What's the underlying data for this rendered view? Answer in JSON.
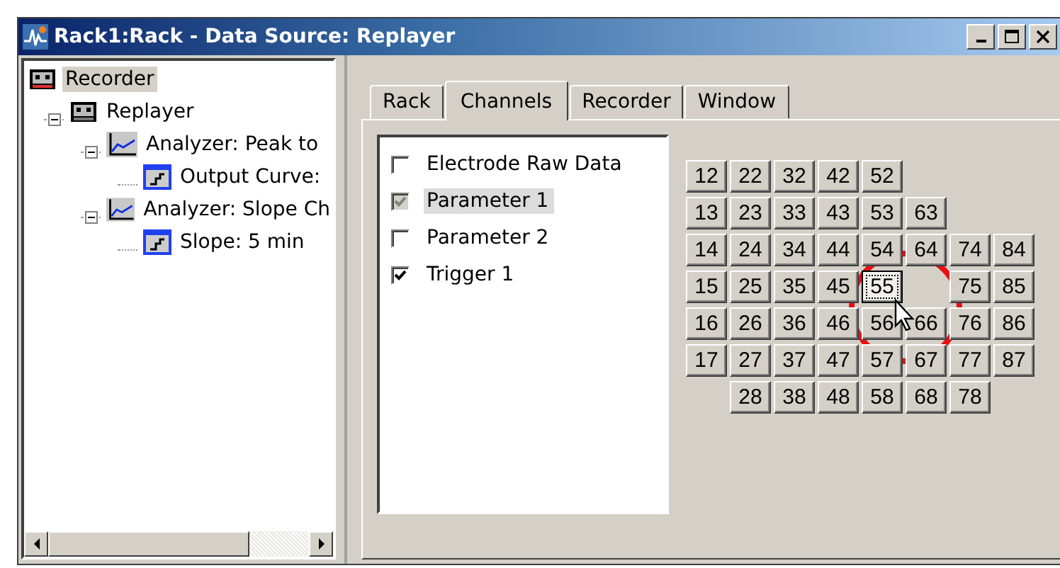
{
  "window": {
    "title": "Rack1:Rack - Data Source: Replayer"
  },
  "tree": [
    {
      "label": "Recorder",
      "kind": "device",
      "selected": true,
      "children": [
        {
          "label": "Replayer",
          "kind": "device",
          "selected": false,
          "expanded": true,
          "children": [
            {
              "label": "Analyzer: Peak to",
              "kind": "analyzer",
              "selected": false,
              "expanded": true,
              "children": [
                {
                  "label": "Output Curve:",
                  "kind": "output",
                  "selected": false
                }
              ]
            },
            {
              "label": "Analyzer: Slope Ch",
              "kind": "analyzer",
              "selected": false,
              "expanded": true,
              "children": [
                {
                  "label": "Slope: 5 min",
                  "kind": "output",
                  "selected": false
                }
              ]
            }
          ]
        }
      ]
    }
  ],
  "tabs": [
    {
      "label": "Rack",
      "selected": false
    },
    {
      "label": "Channels",
      "selected": true
    },
    {
      "label": "Recorder",
      "selected": false
    },
    {
      "label": "Window",
      "selected": false
    }
  ],
  "channel_list": [
    {
      "label": "Electrode Raw Data",
      "checked": false,
      "disabled": false,
      "selected": false
    },
    {
      "label": "Parameter 1",
      "checked": true,
      "disabled": true,
      "selected": true
    },
    {
      "label": "Parameter 2",
      "checked": false,
      "disabled": false,
      "selected": false
    },
    {
      "label": "Trigger 1",
      "checked": true,
      "disabled": false,
      "selected": false
    }
  ],
  "electrode_grid": [
    [
      {
        "kind": "button",
        "label": "12",
        "selected": false
      },
      {
        "kind": "button",
        "label": "22",
        "selected": false
      },
      {
        "kind": "button",
        "label": "32",
        "selected": false
      },
      {
        "kind": "button",
        "label": "42",
        "selected": false
      },
      {
        "kind": "button",
        "label": "52",
        "selected": false
      }
    ],
    [
      {
        "kind": "button",
        "label": "13",
        "selected": false
      },
      {
        "kind": "button",
        "label": "23",
        "selected": false
      },
      {
        "kind": "button",
        "label": "33",
        "selected": false
      },
      {
        "kind": "button",
        "label": "43",
        "selected": false
      },
      {
        "kind": "button",
        "label": "53",
        "selected": false
      },
      {
        "kind": "button",
        "label": "63",
        "selected": false
      }
    ],
    [
      {
        "kind": "button",
        "label": "14",
        "selected": false
      },
      {
        "kind": "button",
        "label": "24",
        "selected": false
      },
      {
        "kind": "button",
        "label": "34",
        "selected": false
      },
      {
        "kind": "button",
        "label": "44",
        "selected": false
      },
      {
        "kind": "button",
        "label": "54",
        "selected": false
      },
      {
        "kind": "button",
        "label": "64",
        "selected": false
      },
      {
        "kind": "button",
        "label": "74",
        "selected": false
      },
      {
        "kind": "button",
        "label": "84",
        "selected": false
      }
    ],
    [
      {
        "kind": "button",
        "label": "15",
        "selected": false
      },
      {
        "kind": "button",
        "label": "25",
        "selected": false
      },
      {
        "kind": "button",
        "label": "35",
        "selected": false
      },
      {
        "kind": "button",
        "label": "45",
        "selected": false
      },
      {
        "kind": "button",
        "label": "55",
        "selected": true
      },
      {
        "kind": "gap"
      },
      {
        "kind": "button",
        "label": "75",
        "selected": false
      },
      {
        "kind": "button",
        "label": "85",
        "selected": false
      }
    ],
    [
      {
        "kind": "button",
        "label": "16",
        "selected": false
      },
      {
        "kind": "button",
        "label": "26",
        "selected": false
      },
      {
        "kind": "button",
        "label": "36",
        "selected": false
      },
      {
        "kind": "button",
        "label": "46",
        "selected": false
      },
      {
        "kind": "button",
        "label": "56",
        "selected": false
      },
      {
        "kind": "button",
        "label": "66",
        "selected": false
      },
      {
        "kind": "button",
        "label": "76",
        "selected": false
      },
      {
        "kind": "button",
        "label": "86",
        "selected": false
      }
    ],
    [
      {
        "kind": "button",
        "label": "17",
        "selected": false
      },
      {
        "kind": "button",
        "label": "27",
        "selected": false
      },
      {
        "kind": "button",
        "label": "37",
        "selected": false
      },
      {
        "kind": "button",
        "label": "47",
        "selected": false
      },
      {
        "kind": "button",
        "label": "57",
        "selected": false
      },
      {
        "kind": "button",
        "label": "67",
        "selected": false
      },
      {
        "kind": "button",
        "label": "77",
        "selected": false
      },
      {
        "kind": "button",
        "label": "87",
        "selected": false
      }
    ],
    [
      {
        "kind": "gap"
      },
      {
        "kind": "button",
        "label": "28",
        "selected": false
      },
      {
        "kind": "button",
        "label": "38",
        "selected": false
      },
      {
        "kind": "button",
        "label": "48",
        "selected": false
      },
      {
        "kind": "button",
        "label": "58",
        "selected": false
      },
      {
        "kind": "button",
        "label": "68",
        "selected": false
      },
      {
        "kind": "button",
        "label": "78",
        "selected": false
      }
    ]
  ]
}
